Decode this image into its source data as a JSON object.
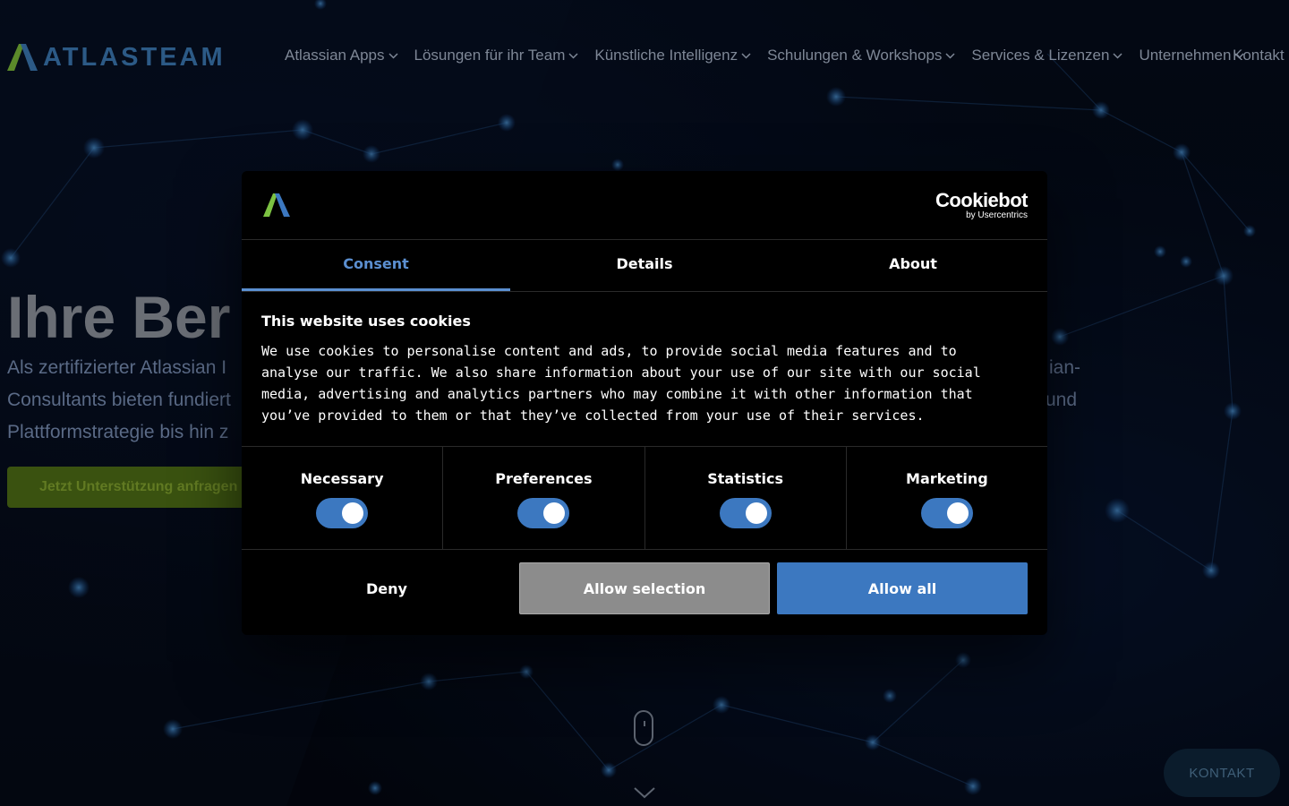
{
  "colors": {
    "accent_blue": "#3c78c0",
    "tab_active": "#5b8fd0",
    "dialog_bg": "#000000",
    "page_bg": "#050b1a",
    "logo_green": "#7cc242",
    "logo_blue": "#2c5a86"
  },
  "header": {
    "logo_text": "ATLASTEAM",
    "nav": [
      {
        "label": "Atlassian Apps",
        "icon": "chevron-down-icon"
      },
      {
        "label": "Lösungen für ihr Team",
        "icon": "chevron-down-icon"
      },
      {
        "label": "Künstliche Intelligenz",
        "icon": "chevron-down-icon"
      },
      {
        "label": "Schulungen & Workshops",
        "icon": "chevron-down-icon"
      },
      {
        "label": "Services & Lizenzen",
        "icon": "chevron-down-icon"
      },
      {
        "label": "Unternehmen",
        "icon": "chevron-down-icon"
      },
      {
        "label": "Kontakt"
      }
    ]
  },
  "hero": {
    "title": "Ihre Ber",
    "subtitle_lines": [
      "Als zertifizierter Atlassian I",
      "Consultants bieten fundiert",
      "Plattformstrategie bis hin z"
    ],
    "subtitle_right": [
      "ian-",
      "und"
    ],
    "cta": "Jetzt Unterstützung anfragen",
    "kontakt_button": "KONTAKT"
  },
  "cookie_dialog": {
    "brand_name": "Cookiebot",
    "brand_by": "by Usercentrics",
    "tabs": [
      {
        "label": "Consent",
        "active": true
      },
      {
        "label": "Details",
        "active": false
      },
      {
        "label": "About",
        "active": false
      }
    ],
    "title": "This website uses cookies",
    "text": "We use cookies to personalise content and ads, to provide social media features and to analyse our traffic. We also share information about your use of our site with our social media, advertising and analytics partners who may combine it with other information that you’ve provided to them or that they’ve collected from your use of their services.",
    "categories": [
      {
        "label": "Necessary",
        "enabled": true
      },
      {
        "label": "Preferences",
        "enabled": true
      },
      {
        "label": "Statistics",
        "enabled": true
      },
      {
        "label": "Marketing",
        "enabled": true
      }
    ],
    "buttons": {
      "deny": "Deny",
      "allow_selection": "Allow selection",
      "allow_all": "Allow all"
    }
  }
}
